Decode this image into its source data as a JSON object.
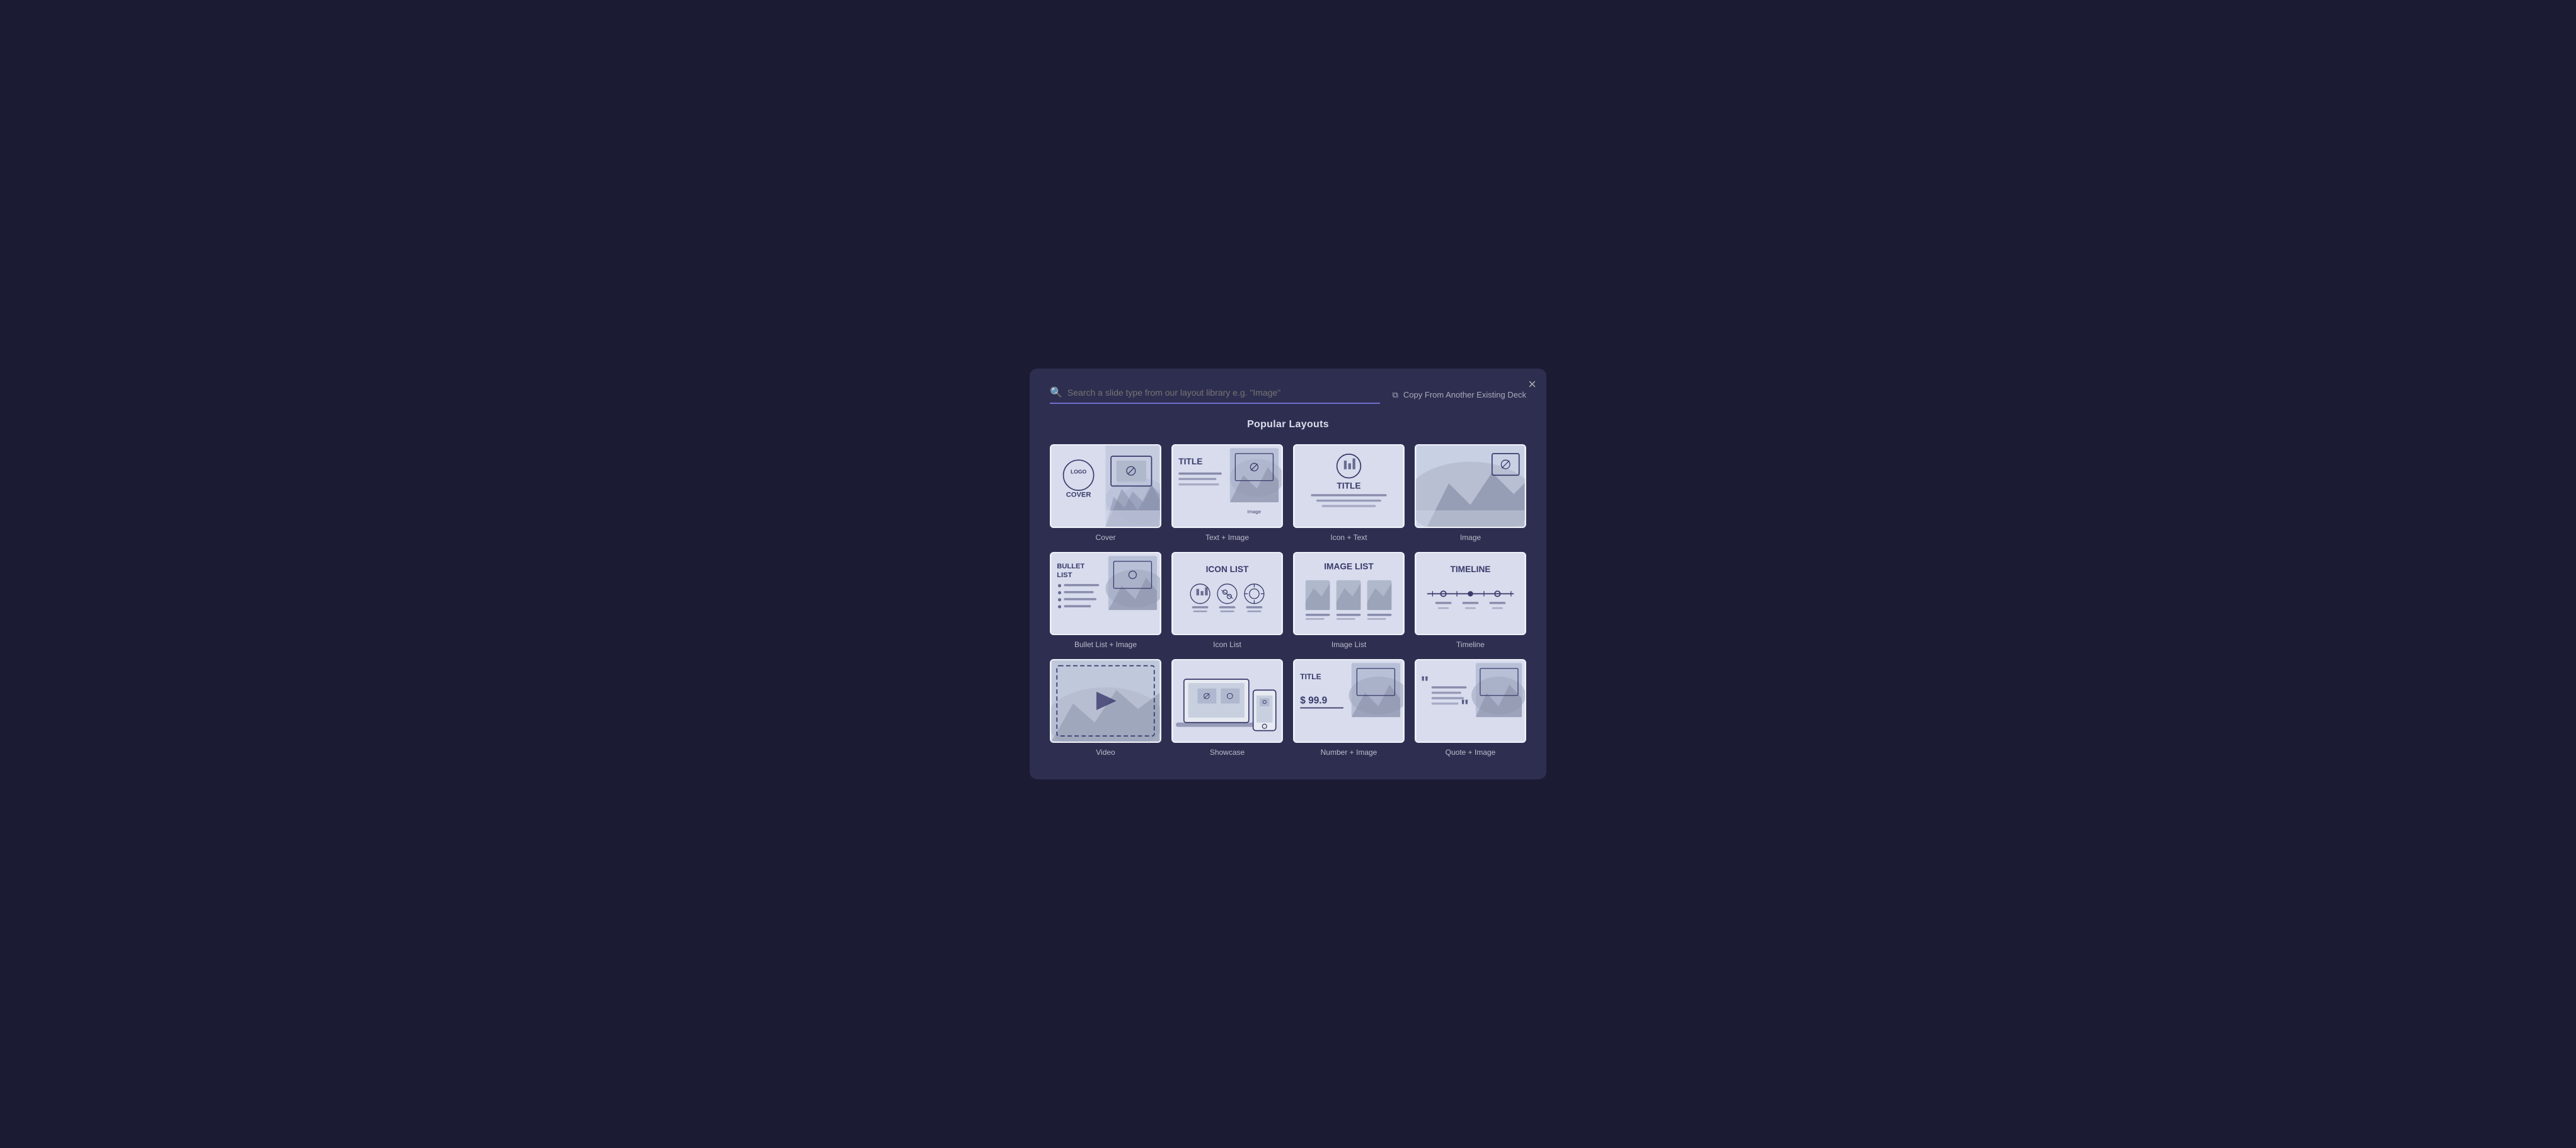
{
  "modal": {
    "title": "Popular Layouts",
    "close_label": "×",
    "search": {
      "placeholder": "Search a slide type from our layout library e.g. \"Image\""
    },
    "copy_button_label": "Copy From Another Existing Deck"
  },
  "layouts": [
    {
      "id": "cover",
      "label": "Cover",
      "type": "cover"
    },
    {
      "id": "text-image",
      "label": "Text + Image",
      "type": "text-image"
    },
    {
      "id": "icon-text",
      "label": "Icon + Text",
      "type": "icon-text"
    },
    {
      "id": "image",
      "label": "Image",
      "type": "image"
    },
    {
      "id": "bullet-list-image",
      "label": "Bullet List + Image",
      "type": "bullet-list"
    },
    {
      "id": "icon-list",
      "label": "Icon List",
      "type": "icon-list"
    },
    {
      "id": "image-list",
      "label": "Image List",
      "type": "image-list"
    },
    {
      "id": "timeline",
      "label": "Timeline",
      "type": "timeline"
    },
    {
      "id": "video",
      "label": "Video",
      "type": "video"
    },
    {
      "id": "showcase",
      "label": "Showcase",
      "type": "showcase"
    },
    {
      "id": "number-image",
      "label": "Number + Image",
      "type": "number-image"
    },
    {
      "id": "quote-image",
      "label": "Quote + Image",
      "type": "quote-image"
    }
  ]
}
